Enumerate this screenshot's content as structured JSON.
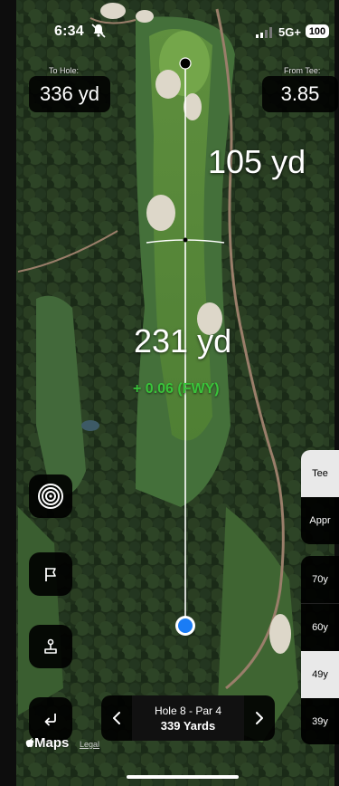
{
  "status": {
    "time": "6:34",
    "network": "5G+",
    "battery": "100"
  },
  "to_hole": {
    "label": "To Hole:",
    "value": "336 yd"
  },
  "from_tee": {
    "label": "From Tee:",
    "value": "3.85"
  },
  "target_distance": "105 yd",
  "shot_distance": "231 yd",
  "strokes_gained": "+ 0.06 (FWY)",
  "clubs": [
    "Tee",
    "Appr",
    "70y",
    "60y",
    "49y",
    "39y"
  ],
  "selected_club": "49y",
  "hole": {
    "title": "Hole 8 - Par 4",
    "yards": "339 Yards"
  },
  "footer": {
    "maps": "Maps",
    "legal": "Legal"
  },
  "colors": {
    "sg_green": "#39c43a",
    "player_blue": "#1a7cf5"
  }
}
